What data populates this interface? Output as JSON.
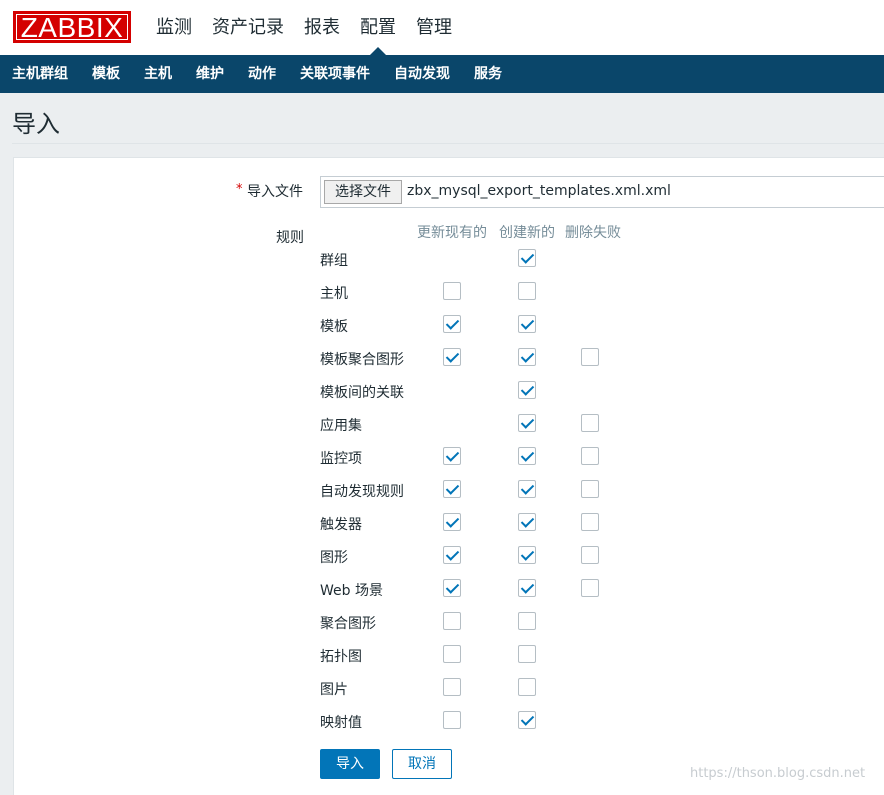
{
  "header": {
    "logo": "ZABBIX",
    "main_nav": [
      "监测",
      "资产记录",
      "报表",
      "配置",
      "管理"
    ],
    "active_main": 3,
    "sub_nav": [
      "主机群组",
      "模板",
      "主机",
      "维护",
      "动作",
      "关联项事件",
      "自动发现",
      "服务"
    ]
  },
  "page": {
    "title": "导入"
  },
  "form": {
    "required_mark": "*",
    "file_label": "导入文件",
    "file_button": "选择文件",
    "file_name": "zbx_mysql_export_templates.xml.xml",
    "rules_label": "规则",
    "columns": [
      "更新现有的",
      "创建新的",
      "删除失败"
    ],
    "rows": [
      {
        "label": "群组",
        "update": null,
        "create": true,
        "delete": null
      },
      {
        "label": "主机",
        "update": false,
        "create": false,
        "delete": null
      },
      {
        "label": "模板",
        "update": true,
        "create": true,
        "delete": null
      },
      {
        "label": "模板聚合图形",
        "update": true,
        "create": true,
        "delete": false
      },
      {
        "label": "模板间的关联",
        "update": null,
        "create": true,
        "delete": null
      },
      {
        "label": "应用集",
        "update": null,
        "create": true,
        "delete": false
      },
      {
        "label": "监控项",
        "update": true,
        "create": true,
        "delete": false
      },
      {
        "label": "自动发现规则",
        "update": true,
        "create": true,
        "delete": false
      },
      {
        "label": "触发器",
        "update": true,
        "create": true,
        "delete": false
      },
      {
        "label": "图形",
        "update": true,
        "create": true,
        "delete": false
      },
      {
        "label": "Web 场景",
        "update": true,
        "create": true,
        "delete": false
      },
      {
        "label": "聚合图形",
        "update": false,
        "create": false,
        "delete": null
      },
      {
        "label": "拓扑图",
        "update": false,
        "create": false,
        "delete": null
      },
      {
        "label": "图片",
        "update": false,
        "create": false,
        "delete": null
      },
      {
        "label": "映射值",
        "update": false,
        "create": true,
        "delete": null
      }
    ],
    "import_button": "导入",
    "cancel_button": "取消"
  },
  "watermark": "https://thson.blog.csdn.net"
}
